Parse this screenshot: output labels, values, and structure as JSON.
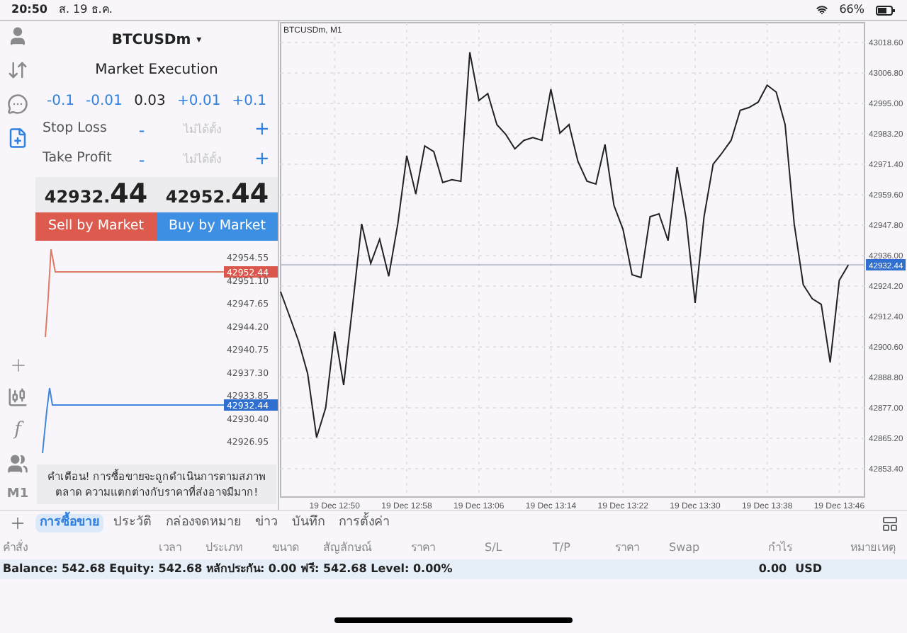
{
  "status_bar": {
    "time": "20:50",
    "date": "ส. 19 ธ.ค.",
    "battery": "66%"
  },
  "left_toolbar": {
    "indicator_glyph": "f",
    "timeframe": "M1"
  },
  "order_panel": {
    "symbol": "BTCUSDm",
    "symbol_caret": "▾",
    "execution": "Market Execution",
    "volume": {
      "steps_minus": [
        "-0.1",
        "-0.01"
      ],
      "value": "0.03",
      "steps_plus": [
        "+0.01",
        "+0.1"
      ]
    },
    "levels": [
      {
        "label": "Stop Loss",
        "minus": "-",
        "placeholder": "ไม่ได้ตั้ง",
        "plus": "+"
      },
      {
        "label": "Take Profit",
        "minus": "-",
        "placeholder": "ไม่ได้ตั้ง",
        "plus": "+"
      }
    ],
    "bid": "42932.**44**",
    "ask": "42952.**44**",
    "sell_button": "Sell by Market",
    "buy_button": "Buy by Market",
    "tick_chart": {
      "axis_labels": [
        "42954.55",
        "42951.10",
        "42947.65",
        "42944.20",
        "42940.75",
        "42937.30",
        "42933.85",
        "42930.40",
        "42926.95"
      ],
      "ask_label": "42952.44",
      "bid_label": "42932.44"
    },
    "warning": "คำเตือน! การซื้อขายจะถูกดำเนินการตามสภาพตลาด ความแตกต่างกับราคาที่ส่งอาจมีมาก!"
  },
  "chart": {
    "price_label": "42932.44",
    "chart_data": {
      "type": "line",
      "title": "BTCUSDm, M1",
      "categories": [
        null,
        null,
        null,
        null,
        null,
        null,
        "19 Dec 12:50",
        null,
        null,
        null,
        null,
        null,
        null,
        null,
        "19 Dec 12:58",
        null,
        null,
        null,
        null,
        null,
        null,
        null,
        "19 Dec 13:06",
        null,
        null,
        null,
        null,
        null,
        null,
        null,
        "19 Dec 13:14",
        null,
        null,
        null,
        null,
        null,
        null,
        null,
        "19 Dec 13:22",
        null,
        null,
        null,
        null,
        null,
        null,
        null,
        "19 Dec 13:30",
        null,
        null,
        null,
        null,
        null,
        null,
        null,
        "19 Dec 13:38",
        null,
        null,
        null,
        null,
        null,
        null,
        null,
        "19 Dec 13:46",
        null
      ],
      "series": [
        {
          "color": "#222222",
          "values": [
            42922.0,
            42912.4,
            42902.8,
            42890.2,
            42865.5,
            42877.0,
            42906.6,
            42885.8,
            42917.0,
            42948.3,
            42933.0,
            42942.3,
            42928.0,
            42948.3,
            42974.7,
            42959.9,
            42978.5,
            42976.3,
            42964.3,
            42965.4,
            42964.8,
            43014.8,
            42996.1,
            42998.8,
            42986.8,
            42982.9,
            42977.4,
            42980.7,
            42981.8,
            42980.7,
            43000.5,
            42983.5,
            42986.8,
            42972.5,
            42964.8,
            42963.7,
            42979.1,
            42955.5,
            42946.2,
            42928.6,
            42927.5,
            42951.1,
            42952.2,
            42941.8,
            42970.3,
            42950.5,
            42917.6,
            42951.1,
            42971.4,
            42975.8,
            42980.7,
            42992.3,
            42993.4,
            42995.5,
            43002.1,
            42999.4,
            42986.8,
            42948.3,
            42924.7,
            42919.3,
            42917.1,
            42894.6,
            42926.4,
            42932.4
          ]
        }
      ],
      "ylim": [
        42842.4,
        43026.3
      ],
      "grid": true,
      "ref_lines": [
        {
          "axis": "y",
          "value": 42932.44,
          "color": "#aab6c4"
        }
      ],
      "yticks": [
        {
          "value": 43018.6,
          "label": "43018.60"
        },
        {
          "value": 43006.8,
          "label": "43006.80"
        },
        {
          "value": 42995,
          "label": "42995.00"
        },
        {
          "value": 42983.2,
          "label": "42983.20"
        },
        {
          "value": 42971.4,
          "label": "42971.40"
        },
        {
          "value": 42959.6,
          "label": "42959.60"
        },
        {
          "value": 42947.8,
          "label": "42947.80"
        },
        {
          "value": 42936,
          "label": "42936.00"
        },
        {
          "value": 42924.2,
          "label": "42924.20"
        },
        {
          "value": 42912.4,
          "label": "42912.40"
        },
        {
          "value": 42900.6,
          "label": "42900.60"
        },
        {
          "value": 42888.8,
          "label": "42888.80"
        },
        {
          "value": 42877,
          "label": "42877.00"
        },
        {
          "value": 42865.2,
          "label": "42865.20"
        },
        {
          "value": 42853.4,
          "label": "42853.40"
        }
      ]
    }
  },
  "bottom_tabs": [
    {
      "label": "การซื้อขาย",
      "selected": true
    },
    {
      "label": "ประวัติ",
      "selected": false
    },
    {
      "label": "กล่องจดหมาย",
      "selected": false
    },
    {
      "label": "ข่าว",
      "selected": false
    },
    {
      "label": "บันทึก",
      "selected": false
    },
    {
      "label": "การตั้งค่า",
      "selected": false
    }
  ],
  "table": {
    "columns": [
      "คำสั่ง",
      "เวลา",
      "ประเภท",
      "ขนาด",
      "สัญลักษณ์",
      "ราคา",
      "S/L",
      "T/P",
      "ราคา",
      "Swap",
      "กำไร",
      "หมายเหตุ"
    ]
  },
  "account": {
    "summary": "Balance: 542.68 Equity: 542.68 หลักประกัน: 0.00 ฟรี: 542.68 Level: 0.00%",
    "profit": "0.00",
    "currency": "USD"
  }
}
